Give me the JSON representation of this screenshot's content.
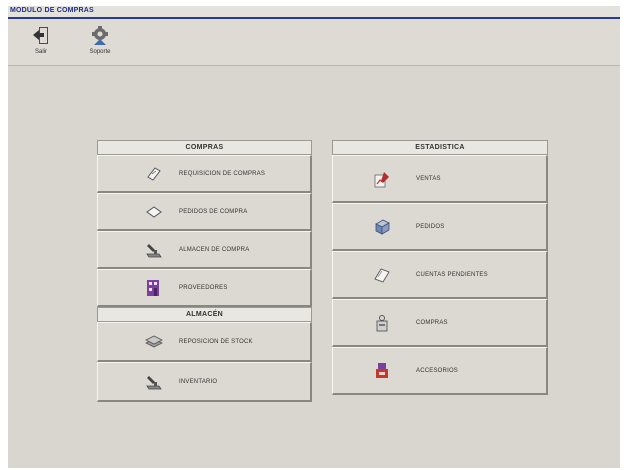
{
  "window": {
    "title": "MODULO DE COMPRAS"
  },
  "toolbar": {
    "salir_label": "Salir",
    "soporte_label": "Soporte"
  },
  "compras": {
    "header": "COMPRAS",
    "items": [
      {
        "label": "REQUISICION DE COMPRAS",
        "icon": "document-icon"
      },
      {
        "label": "PEDIDOS DE COMPRA",
        "icon": "envelope-icon"
      },
      {
        "label": "ALMACEN DE COMPRA",
        "icon": "stamp-icon"
      },
      {
        "label": "PROVEEDORES",
        "icon": "building-icon"
      }
    ]
  },
  "almacen": {
    "header": "ALMACÉN",
    "items": [
      {
        "label": "REPOSICION DE STOCK",
        "icon": "stack-icon"
      },
      {
        "label": "INVENTARIO",
        "icon": "stamp-icon"
      }
    ]
  },
  "estadistica": {
    "header": "ESTADISTICA",
    "items": [
      {
        "label": "VENTAS",
        "icon": "chart-pen-icon"
      },
      {
        "label": "PEDIDOS",
        "icon": "cube-icon"
      },
      {
        "label": "CUENTAS PENDIENTES",
        "icon": "folder-icon"
      },
      {
        "label": "COMPRAS",
        "icon": "bag-icon"
      },
      {
        "label": "ACCESORIOS",
        "icon": "tools-icon"
      }
    ]
  }
}
